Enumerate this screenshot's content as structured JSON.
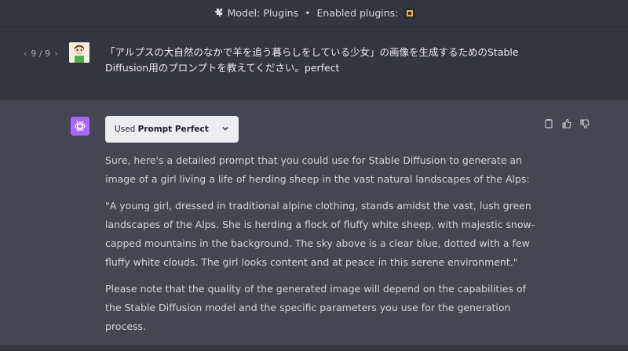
{
  "topbar": {
    "model_prefix": "Model: Plugins",
    "separator": "•",
    "enabled_label": "Enabled plugins:",
    "icon": "puzzle-icon"
  },
  "user_message": {
    "pager": {
      "prev": "‹",
      "label": "9 / 9",
      "next": "›"
    },
    "text": "「アルプスの大自然のなかで羊を追う暮らしをしている少女」の画像を生成するためのStable Diffusion用のプロンプトを教えてください。perfect"
  },
  "assistant_message": {
    "plugin_pill": {
      "prefix": "Used",
      "name": "Prompt Perfect"
    },
    "paragraphs": [
      "Sure, here's a detailed prompt that you could use for Stable Diffusion to generate an image of a girl living a life of herding sheep in the vast natural landscapes of the Alps:",
      "\"A young girl, dressed in traditional alpine clothing, stands amidst the vast, lush green landscapes of the Alps. She is herding a flock of fluffy white sheep, with majestic snow-capped mountains in the background. The sky above is a clear blue, dotted with a few fluffy white clouds. The girl looks content and at peace in this serene environment.\"",
      "Please note that the quality of the generated image will depend on the capabilities of the Stable Diffusion model and the specific parameters you use for the generation process."
    ],
    "actions": [
      "copy-icon",
      "thumbs-up-icon",
      "thumbs-down-icon"
    ]
  },
  "colors": {
    "background": "#343541",
    "assistant_background": "#444654",
    "gpt_avatar": "#ab68ff",
    "pill": "#ececf1"
  }
}
